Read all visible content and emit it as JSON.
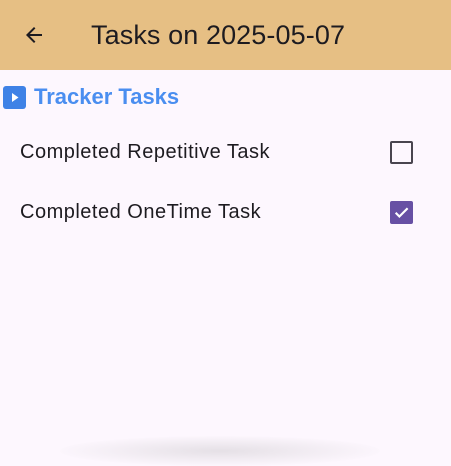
{
  "appbar": {
    "title": "Tasks on 2025-05-07",
    "back_icon": "arrow-left-icon",
    "background": "#e6bf84"
  },
  "section": {
    "icon": "play-square-icon",
    "title": "Tracker Tasks",
    "accent": "#4a8ef0"
  },
  "tasks": [
    {
      "label": "Completed Repetitive Task",
      "checked": false
    },
    {
      "label": "Completed OneTime Task",
      "checked": true
    }
  ],
  "colors": {
    "background": "#fdf7fe",
    "checkbox_checked": "#6750a4",
    "checkbox_border": "#49454f"
  }
}
